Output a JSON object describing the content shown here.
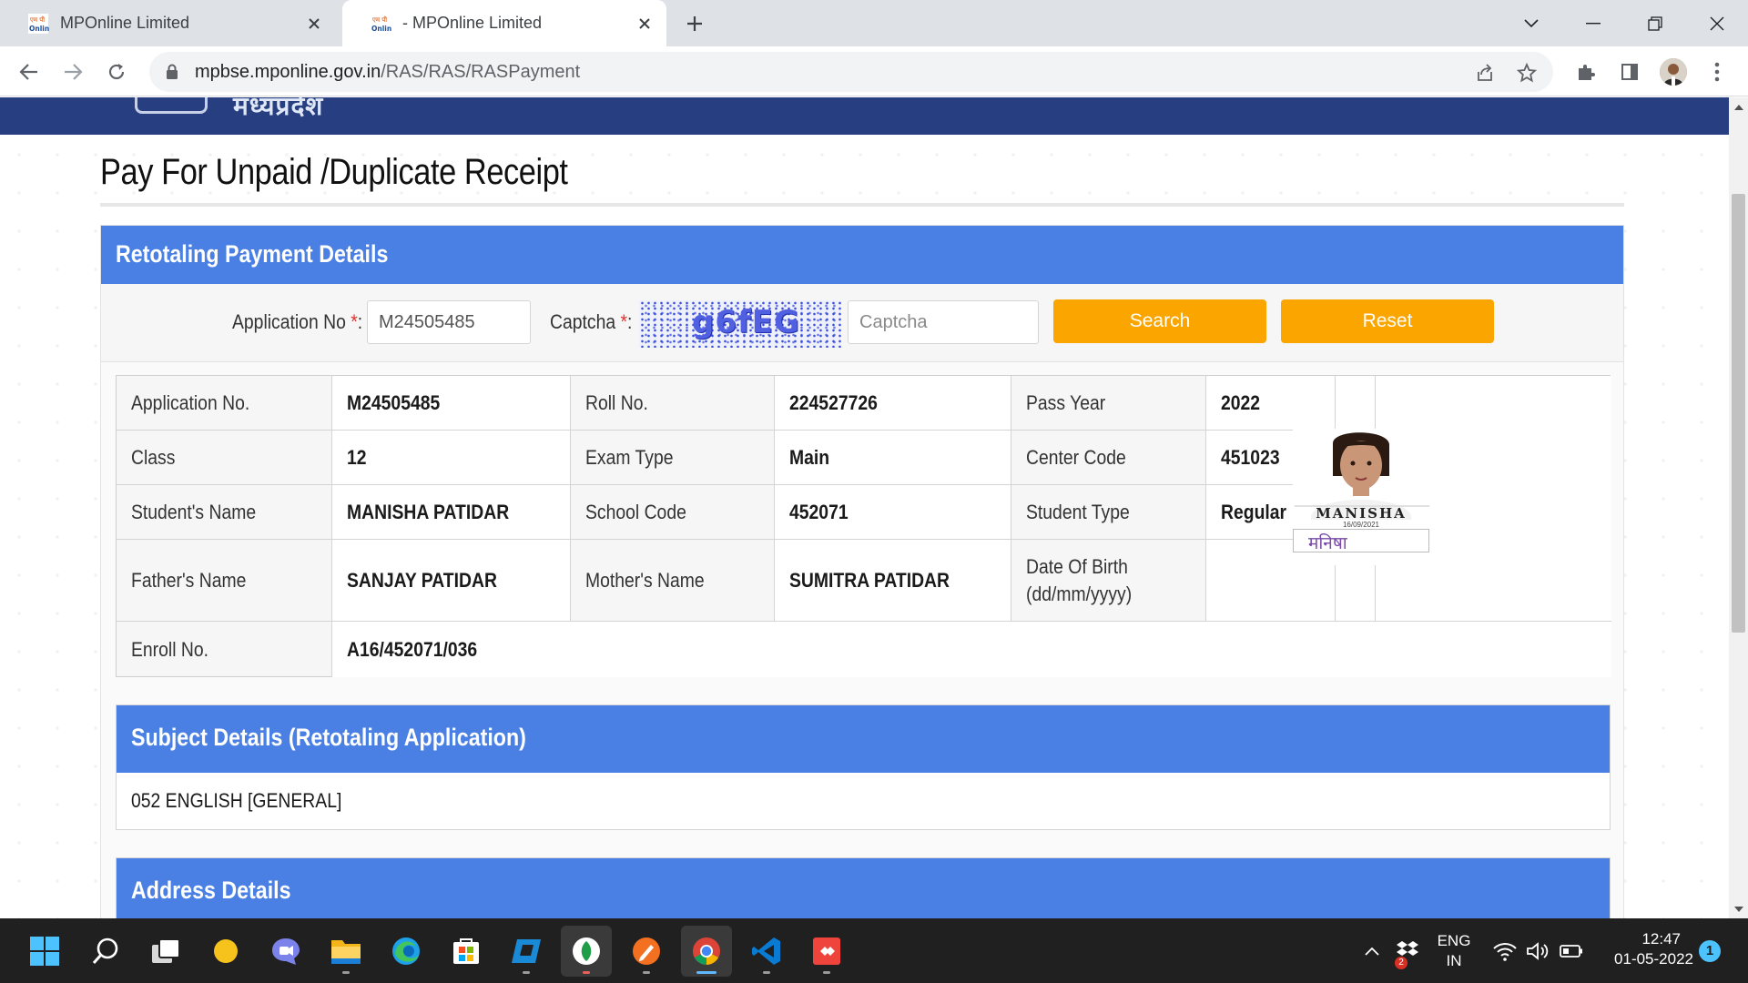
{
  "browser": {
    "tabs": [
      {
        "title": "MPOnline Limited",
        "active": false
      },
      {
        "title": "- MPOnline Limited",
        "active": true
      }
    ],
    "url_host": "mpbse.mponline.gov.in",
    "url_path": "/RAS/RAS/RASPayment"
  },
  "page": {
    "title": "Pay For Unpaid /Duplicate Receipt",
    "panel_title": "Retotaling Payment Details",
    "search": {
      "application_label": "Application No",
      "application_value": "M24505485",
      "captcha_label": "Captcha",
      "required_mark": "*",
      "label_colon": ":",
      "captcha_image_text": "g6fEG",
      "captcha_placeholder": "Captcha",
      "search_button": "Search",
      "reset_button": "Reset"
    },
    "details": {
      "application_no_label": "Application No.",
      "application_no": "M24505485",
      "roll_no_label": "Roll No.",
      "roll_no": "224527726",
      "pass_year_label": "Pass Year",
      "pass_year": "2022",
      "class_label": "Class",
      "class": "12",
      "exam_type_label": "Exam Type",
      "exam_type": "Main",
      "center_code_label": "Center Code",
      "center_code": "451023",
      "student_name_label": "Student's Name",
      "student_name": "MANISHA PATIDAR",
      "school_code_label": "School Code",
      "school_code": "452071",
      "student_type_label": "Student Type",
      "student_type": "Regular",
      "father_name_label": "Father's Name",
      "father_name": "SANJAY PATIDAR",
      "mother_name_label": "Mother's Name",
      "mother_name": "SUMITRA PATIDAR",
      "dob_label_line1": "Date Of Birth",
      "dob_label_line2": "(dd/mm/yyyy)",
      "dob": "",
      "enroll_no_label": "Enroll No.",
      "enroll_no": "A16/452071/036",
      "photo_name": "MANISHA",
      "photo_date": "16/09/2021",
      "photo_signature": "मनिषा"
    },
    "subject_section": {
      "title": "Subject Details (Retotaling Application)",
      "subject": "052 ENGLISH [GENERAL]"
    },
    "address_section": {
      "title": "Address Details"
    }
  },
  "taskbar": {
    "language_line1": "ENG",
    "language_line2": "IN",
    "time": "12:47",
    "date": "01-05-2022",
    "notification_count": "1",
    "dropbox_badge": "2"
  },
  "colors": {
    "header_blue": "#4a80e4",
    "button_orange": "#fba500",
    "site_banner": "#273e80"
  }
}
